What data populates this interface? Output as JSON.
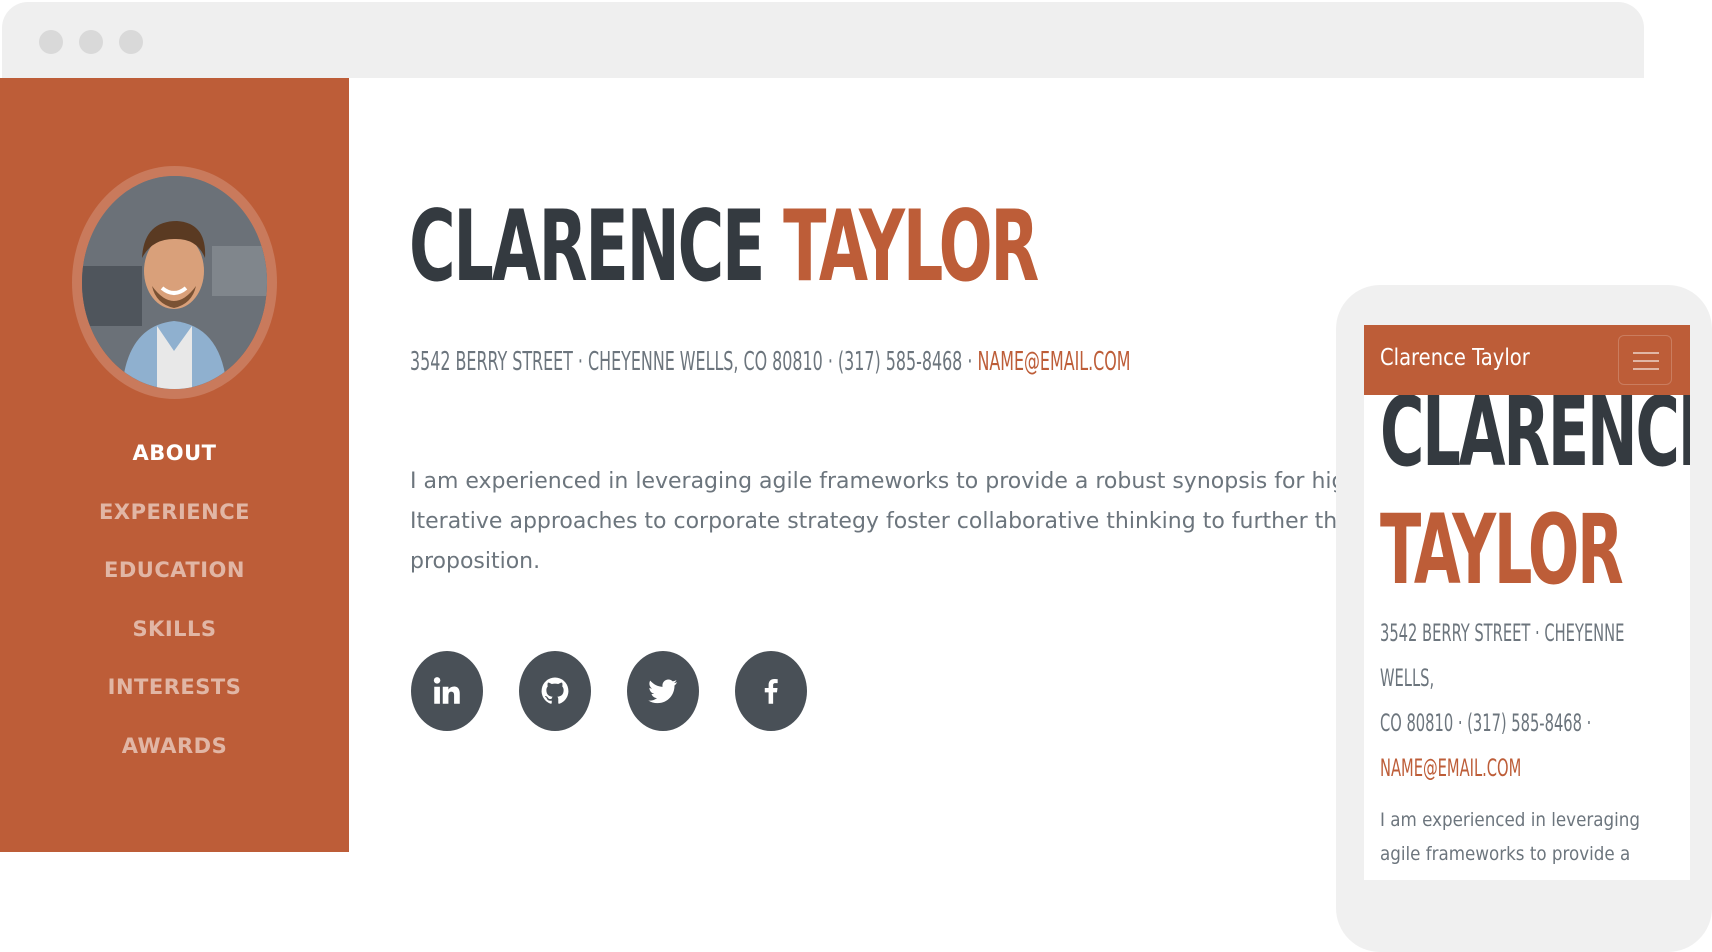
{
  "desktop": {
    "sidebar": {
      "nav_items": [
        {
          "label": "ABOUT",
          "active": true
        },
        {
          "label": "EXPERIENCE",
          "active": false
        },
        {
          "label": "EDUCATION",
          "active": false
        },
        {
          "label": "SKILLS",
          "active": false
        },
        {
          "label": "INTERESTS",
          "active": false
        },
        {
          "label": "AWARDS",
          "active": false
        }
      ]
    },
    "header": {
      "first_name": "CLARENCE",
      "last_name": "TAYLOR",
      "contact_text": "3542 BERRY STREET · CHEYENNE WELLS, CO 80810 · (317) 585-8468 · ",
      "email": "NAME@EMAIL.COM"
    },
    "bio": {
      "line1": "I am experienced in leveraging agile frameworks to provide a robust synopsis for high",
      "line2": "Iterative approaches to corporate strategy foster collaborative thinking to further the",
      "line3": "proposition."
    },
    "social": [
      "linkedin-icon",
      "github-icon",
      "twitter-icon",
      "facebook-icon"
    ]
  },
  "mobile": {
    "brand": "Clarence Taylor",
    "first_name": "CLARENCE",
    "last_name": "TAYLOR",
    "contact_line1": "3542 BERRY STREET · CHEYENNE WELLS,",
    "contact_line2": "CO 80810 · (317) 585-8468 ·",
    "email": "NAME@EMAIL.COM",
    "bio_line1": "I am experienced in leveraging",
    "bio_line2": "agile frameworks to provide a"
  },
  "colors": {
    "accent": "#bd5d38",
    "dark": "#343a40",
    "muted": "#6c757d",
    "social_bg": "#495057"
  }
}
